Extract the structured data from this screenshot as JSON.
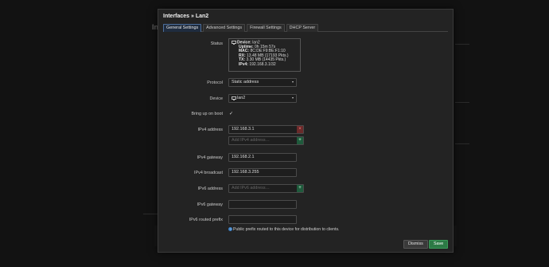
{
  "background": {
    "title_fragment": "Int"
  },
  "modal": {
    "title": "Interfaces » Lan2",
    "tabs": [
      {
        "label": "General Settings",
        "active": true
      },
      {
        "label": "Advanced Settings",
        "active": false
      },
      {
        "label": "Firewall Settings",
        "active": false
      },
      {
        "label": "DHCP Server",
        "active": false
      }
    ]
  },
  "form": {
    "status": {
      "label": "Status",
      "lines": [
        {
          "key": "Device:",
          "value": "lan2"
        },
        {
          "key": "Uptime:",
          "value": "0h 15m 57s"
        },
        {
          "key": "MAC:",
          "value": "8C:DE:F9:BE:F1:10"
        },
        {
          "key": "RX:",
          "value": "13.48 MB (17193 Pkts.)"
        },
        {
          "key": "TX:",
          "value": "3.30 MB (14435 Pkts.)"
        },
        {
          "key": "IPv4:",
          "value": "192.168.3.1/32"
        }
      ]
    },
    "protocol": {
      "label": "Protocol",
      "value": "Static address"
    },
    "device": {
      "label": "Device",
      "value": "lan2"
    },
    "bring_up": {
      "label": "Bring up on boot",
      "checked": true,
      "mark": "✓"
    },
    "ipv4_address": {
      "label": "IPv4 address",
      "value": "192.168.3.1",
      "placeholder": "Add IPv4 address…",
      "remove_glyph": "×",
      "add_glyph": "+"
    },
    "ipv4_gateway": {
      "label": "IPv4 gateway",
      "value": "192.168.2.1"
    },
    "ipv4_broadcast": {
      "label": "IPv4 broadcast",
      "value": "192.168.3.255"
    },
    "ipv6_address": {
      "label": "IPv6 address",
      "placeholder": "Add IPv6 address…",
      "add_glyph": "+"
    },
    "ipv6_gateway": {
      "label": "IPv6 gateway",
      "value": ""
    },
    "ipv6_routed_prefix": {
      "label": "IPv6 routed prefix",
      "value": "",
      "hint": "Public prefix routed to this device for distribution to clients.",
      "hint_icon": "?"
    }
  },
  "footer": {
    "dismiss_label": "Dismiss",
    "save_label": "Save"
  },
  "colors": {
    "save": "#2c7a45",
    "add": "#1f5a3c",
    "remove": "#6a2a2a",
    "active_tab": "#1f2c3f",
    "info": "#3b7fc4"
  }
}
